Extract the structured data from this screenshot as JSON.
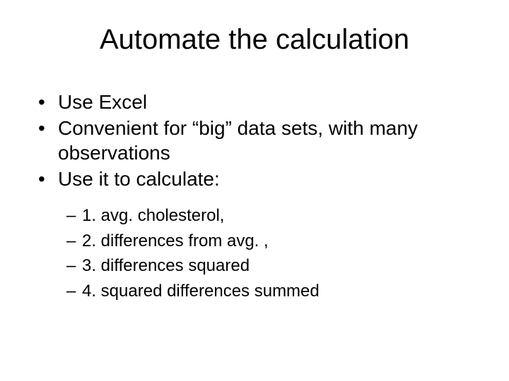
{
  "title": "Automate the calculation",
  "bullets": [
    "Use Excel",
    "Convenient for “big” data sets, with many observations",
    "Use it to calculate:"
  ],
  "subBullets": [
    "1. avg. cholesterol,",
    "2. differences from avg. ,",
    "3. differences squared",
    "4.  squared differences summed"
  ],
  "markers": {
    "bullet": "•",
    "dash": "–"
  }
}
